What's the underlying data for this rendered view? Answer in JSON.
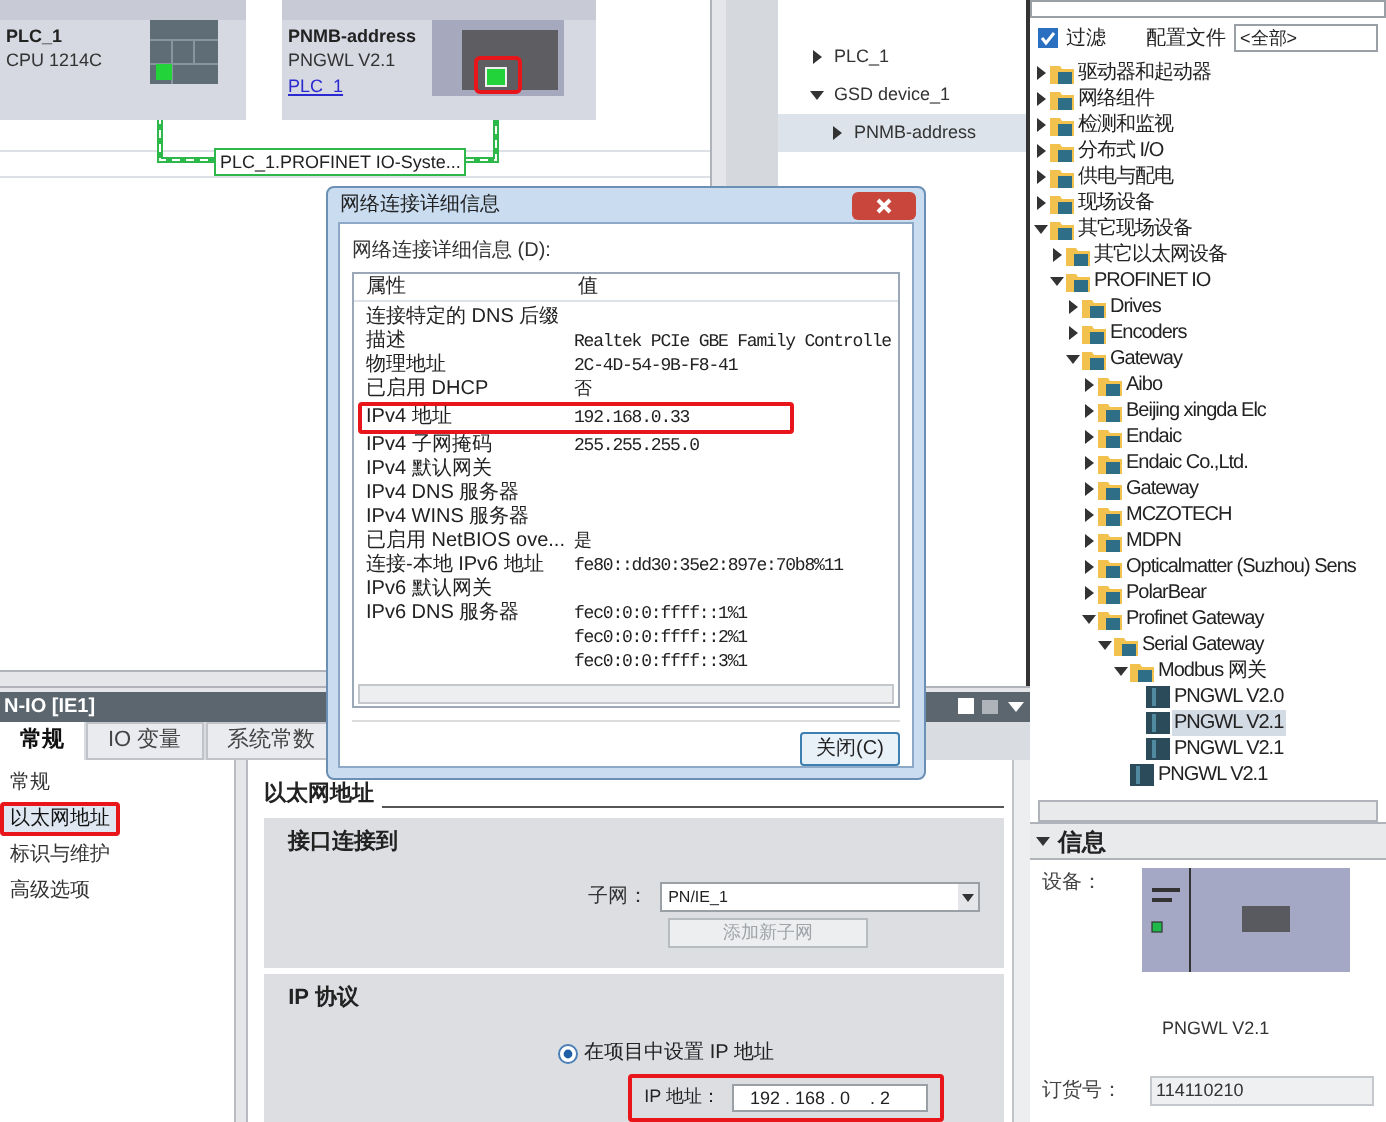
{
  "network_view": {
    "devices": [
      {
        "kind": "plc",
        "name": "PLC_1",
        "type": "CPU 1214C",
        "annotated": false
      },
      {
        "kind": "gateway",
        "name": "PNMB-address",
        "type": "PNGWL V2.1",
        "link": "PLC_1",
        "annotated": true
      }
    ],
    "connection_label": "PLC_1.PROFINET IO-Syste..."
  },
  "project_tree": {
    "items": [
      {
        "label": "PLC_1",
        "expanded": false,
        "selected": false
      },
      {
        "label": "GSD device_1",
        "expanded": true,
        "selected": false,
        "children": [
          {
            "label": "PNMB-address",
            "expanded": false,
            "selected": true
          }
        ]
      }
    ]
  },
  "dialog": {
    "title": "网络连接详细信息",
    "caption": "网络连接详细信息 (D):",
    "columns": [
      "属性",
      "值"
    ],
    "rows": [
      {
        "property": "连接特定的 DNS 后缀",
        "annotated": false
      },
      {
        "property": "描述",
        "value": "Realtek PCIe GBE Family Controlle",
        "annotated": false
      },
      {
        "property": "物理地址",
        "value": "2C-4D-54-9B-F8-41",
        "annotated": false
      },
      {
        "property": "已启用 DHCP",
        "value": "否",
        "annotated": false
      },
      {
        "property": "IPv4 地址",
        "value": "192.168.0.33",
        "annotated": true
      },
      {
        "property": "IPv4 子网掩码",
        "value": "255.255.255.0",
        "annotated": false
      },
      {
        "property": "IPv4 默认网关",
        "annotated": false
      },
      {
        "property": "IPv4 DNS 服务器",
        "annotated": false
      },
      {
        "property": "IPv4 WINS 服务器",
        "annotated": false
      },
      {
        "property": "已启用 NetBIOS ove...",
        "value": "是",
        "annotated": false
      },
      {
        "property": "连接-本地 IPv6 地址",
        "value": "fe80::dd30:35e2:897e:70b8%11",
        "annotated": false
      },
      {
        "property": "IPv6 默认网关",
        "annotated": false
      },
      {
        "property": "IPv6 DNS 服务器",
        "value": "fec0:0:0:ffff::1%1",
        "annotated": false
      },
      {
        "value": "fec0:0:0:ffff::2%1",
        "annotated": false
      },
      {
        "value": "fec0:0:0:ffff::3%1",
        "annotated": false
      }
    ],
    "close_button": "关闭(C)"
  },
  "inspector": {
    "title": "N-IO [IE1]",
    "tabs": [
      {
        "label": "常规",
        "selected": true
      },
      {
        "label": "IO 变量",
        "selected": false
      },
      {
        "label": "系统常数",
        "selected": false
      }
    ],
    "nav": [
      {
        "label": "常规",
        "selected": false,
        "annotated": false
      },
      {
        "label": "以太网地址",
        "selected": true,
        "annotated": true
      },
      {
        "label": "标识与维护",
        "selected": false,
        "annotated": false
      },
      {
        "label": "高级选项",
        "selected": false,
        "annotated": false
      }
    ],
    "section_title": "以太网地址",
    "interface": {
      "title": "接口连接到",
      "subnet_label": "子网：",
      "subnet": "PN/IE_1",
      "add_button": {
        "label": "添加新子网",
        "disabled": true
      }
    },
    "ip": {
      "title": "IP 协议",
      "option": {
        "label": "在项目中设置 IP 地址",
        "selected": true
      },
      "address_label": "IP 地址：",
      "address": "192 . 168 . 0    . 2",
      "annotated": true
    }
  },
  "catalog": {
    "filter": {
      "label": "过滤",
      "checked": true
    },
    "profile_label": "配置文件",
    "profile": "<全部>",
    "tree": [
      {
        "kind": "folder",
        "label": "驱动器和起动器",
        "expanded": false
      },
      {
        "kind": "folder",
        "label": "网络组件",
        "expanded": false
      },
      {
        "kind": "folder",
        "label": "检测和监视",
        "expanded": false
      },
      {
        "kind": "folder",
        "label": "分布式 I/O",
        "expanded": false
      },
      {
        "kind": "folder",
        "label": "供电与配电",
        "expanded": false
      },
      {
        "kind": "folder",
        "label": "现场设备",
        "expanded": false
      },
      {
        "kind": "folder",
        "label": "其它现场设备",
        "expanded": true,
        "children": [
          {
            "kind": "folder",
            "label": "其它以太网设备",
            "expanded": false
          },
          {
            "kind": "folder",
            "label": "PROFINET IO",
            "expanded": true,
            "children": [
              {
                "kind": "folder",
                "label": "Drives",
                "expanded": false
              },
              {
                "kind": "folder",
                "label": "Encoders",
                "expanded": false
              },
              {
                "kind": "folder",
                "label": "Gateway",
                "expanded": true,
                "children": [
                  {
                    "kind": "folder",
                    "label": "Aibo",
                    "expanded": false
                  },
                  {
                    "kind": "folder",
                    "label": "Beijing xingda Elc",
                    "expanded": false
                  },
                  {
                    "kind": "folder",
                    "label": "Endaic",
                    "expanded": false
                  },
                  {
                    "kind": "folder",
                    "label": "Endaic Co.,Ltd.",
                    "expanded": false
                  },
                  {
                    "kind": "folder",
                    "label": "Gateway",
                    "expanded": false
                  },
                  {
                    "kind": "folder",
                    "label": "MCZOTECH",
                    "expanded": false
                  },
                  {
                    "kind": "folder",
                    "label": "MDPN",
                    "expanded": false
                  },
                  {
                    "kind": "folder",
                    "label": "Opticalmatter (Suzhou) Sens",
                    "expanded": false
                  },
                  {
                    "kind": "folder",
                    "label": "PolarBear",
                    "expanded": false
                  },
                  {
                    "kind": "folder",
                    "label": "Profinet Gateway",
                    "expanded": true,
                    "children": [
                      {
                        "kind": "folder",
                        "label": "Serial Gateway",
                        "expanded": true,
                        "children": [
                          {
                            "kind": "folder",
                            "label": "Modbus 网关",
                            "expanded": true,
                            "children": [
                              {
                                "kind": "device",
                                "label": "PNGWL V2.0",
                                "selected": false
                              },
                              {
                                "kind": "device",
                                "label": "PNGWL V2.1",
                                "selected": true
                              },
                              {
                                "kind": "device",
                                "label": "PNGWL V2.1",
                                "selected": false
                              }
                            ]
                          },
                          {
                            "kind": "device",
                            "label": "PNGWL V2.1",
                            "selected": false
                          }
                        ]
                      }
                    ]
                  }
                ]
              }
            ]
          }
        ]
      }
    ]
  },
  "info": {
    "title": "信息",
    "expanded": true,
    "device_label": "设备：",
    "device_name": "PNGWL V2.1",
    "order_label": "订货号：",
    "order_number": "114110210"
  }
}
